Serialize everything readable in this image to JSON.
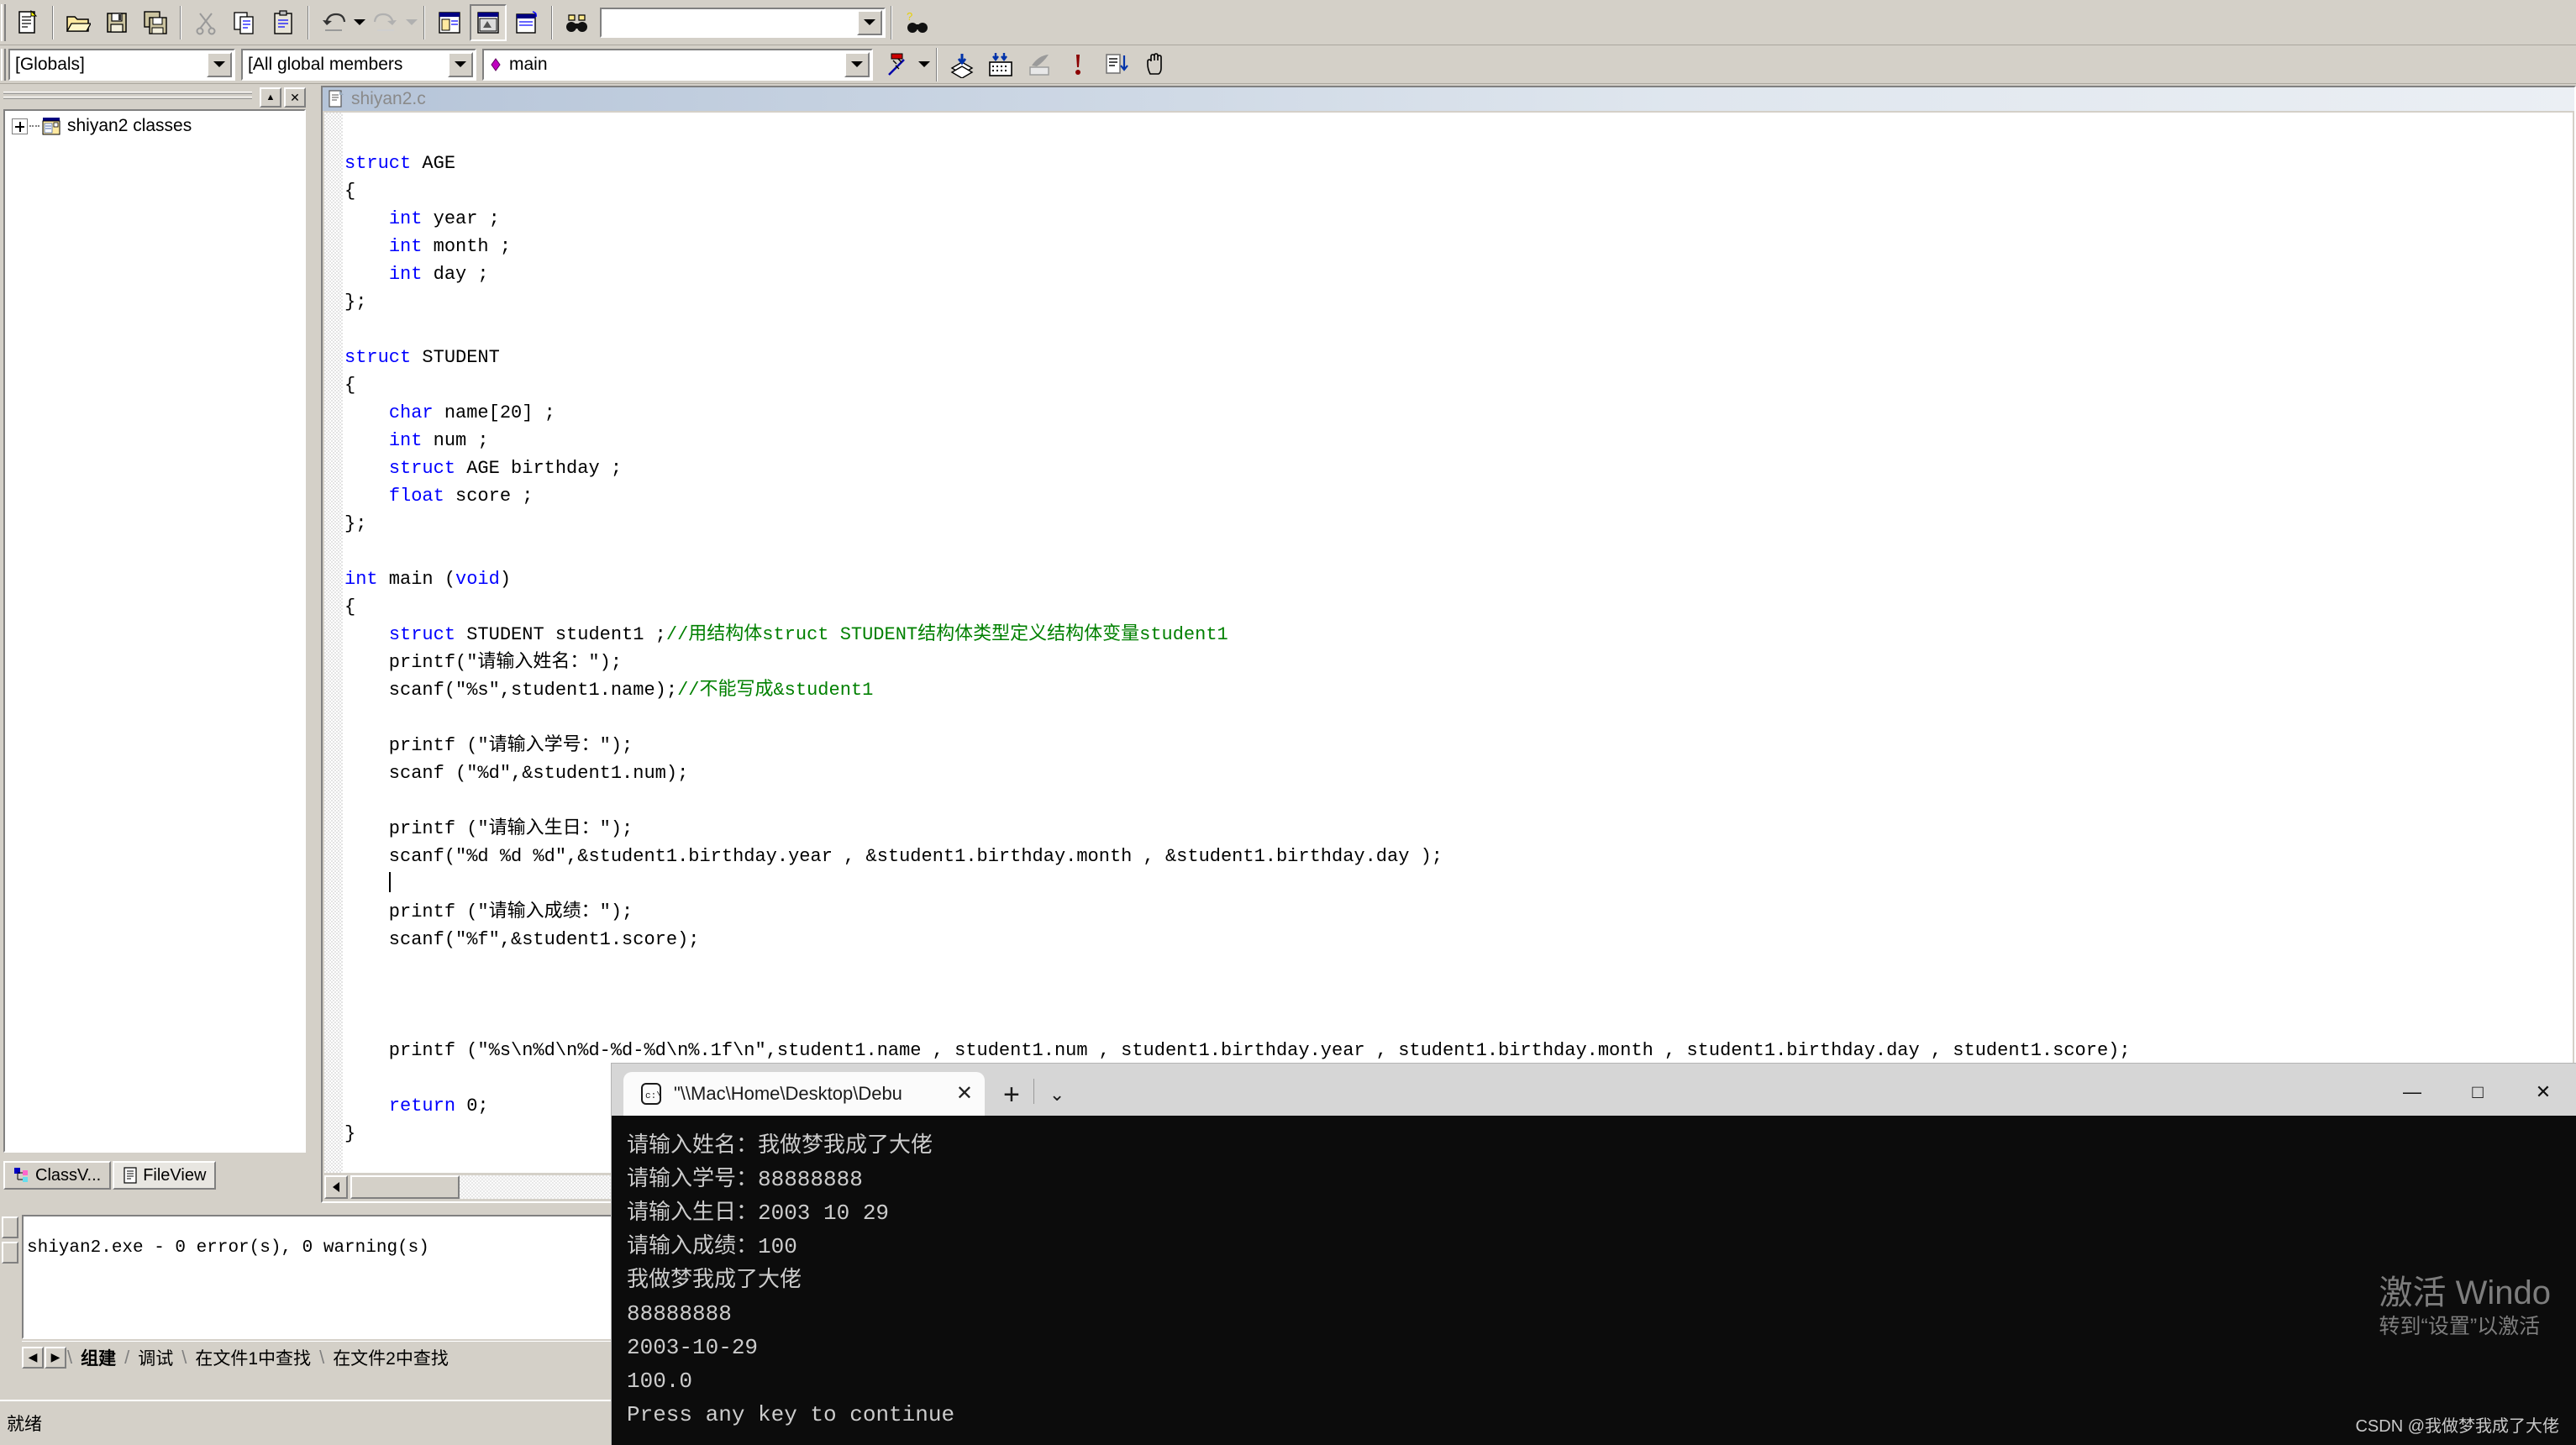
{
  "toolbar_standard": {
    "buttons": [
      {
        "name": "new-document-button",
        "icon": "new-document-icon"
      },
      {
        "name": "open-file-button",
        "icon": "open-folder-icon"
      },
      {
        "name": "save-button",
        "icon": "floppy-disk-icon"
      },
      {
        "name": "save-all-button",
        "icon": "save-all-icon"
      },
      {
        "name": "cut-button",
        "icon": "scissors-icon"
      },
      {
        "name": "copy-button",
        "icon": "copy-icon"
      },
      {
        "name": "paste-button",
        "icon": "clipboard-paste-icon"
      },
      {
        "name": "undo-button",
        "icon": "undo-arrow-icon"
      },
      {
        "name": "redo-button",
        "icon": "redo-arrow-icon"
      },
      {
        "name": "workspace-toggle-button",
        "icon": "workspace-window-icon"
      },
      {
        "name": "output-toggle-button",
        "icon": "output-window-icon"
      },
      {
        "name": "watch-toggle-button",
        "icon": "watch-window-icon"
      },
      {
        "name": "find-in-files-button",
        "icon": "binoculars-icon"
      }
    ],
    "find_combo": {
      "value": "",
      "placeholder": ""
    },
    "help_button": {
      "name": "find-help-button",
      "icon": "question-binoculars-icon"
    }
  },
  "wizard_bar": {
    "globals_combo": {
      "value": "[Globals]"
    },
    "members_combo": {
      "value": "[All global members"
    },
    "function_combo": {
      "value": "main",
      "icon": "magenta-diamond-icon"
    },
    "class_wizard_button": {
      "name": "class-wizard-button",
      "icon": "classwizard-icon"
    },
    "build_buttons": [
      {
        "name": "compile-button",
        "icon": "compile-stack-icon"
      },
      {
        "name": "build-button",
        "icon": "build-grid-icon"
      },
      {
        "name": "stop-build-button",
        "icon": "stop-build-icon"
      },
      {
        "name": "execute-program-button",
        "icon": "red-exclamation-icon"
      },
      {
        "name": "go-debug-button",
        "icon": "document-arrow-down-icon"
      },
      {
        "name": "insert-breakpoint-button",
        "icon": "hand-icon"
      }
    ]
  },
  "workspace": {
    "title_close_label": "✕",
    "title_up_label": "▲",
    "tree": {
      "root_label": "shiyan2 classes",
      "root_icon": "classes-folder-icon",
      "expander": "+"
    },
    "tabs": [
      {
        "label": "ClassV...",
        "icon": "classview-icon",
        "active": false
      },
      {
        "label": "FileView",
        "icon": "fileview-icon",
        "active": true
      }
    ]
  },
  "editor": {
    "tab_title": "shiyan2.c",
    "tab_icon": "c-source-file-icon",
    "code_lines": [
      [
        {
          "t": "struct",
          "c": "kw"
        },
        {
          "t": " AGE",
          "c": ""
        }
      ],
      [
        {
          "t": "{",
          "c": ""
        }
      ],
      [
        {
          "t": "    ",
          "c": ""
        },
        {
          "t": "int",
          "c": "kw"
        },
        {
          "t": " year ;",
          "c": ""
        }
      ],
      [
        {
          "t": "    ",
          "c": ""
        },
        {
          "t": "int",
          "c": "kw"
        },
        {
          "t": " month ;",
          "c": ""
        }
      ],
      [
        {
          "t": "    ",
          "c": ""
        },
        {
          "t": "int",
          "c": "kw"
        },
        {
          "t": " day ;",
          "c": ""
        }
      ],
      [
        {
          "t": "};",
          "c": ""
        }
      ],
      [
        {
          "t": "",
          "c": ""
        }
      ],
      [
        {
          "t": "struct",
          "c": "kw"
        },
        {
          "t": " STUDENT",
          "c": ""
        }
      ],
      [
        {
          "t": "{",
          "c": ""
        }
      ],
      [
        {
          "t": "    ",
          "c": ""
        },
        {
          "t": "char",
          "c": "kw"
        },
        {
          "t": " name[20] ;",
          "c": ""
        }
      ],
      [
        {
          "t": "    ",
          "c": ""
        },
        {
          "t": "int",
          "c": "kw"
        },
        {
          "t": " num ;",
          "c": ""
        }
      ],
      [
        {
          "t": "    ",
          "c": ""
        },
        {
          "t": "struct",
          "c": "kw"
        },
        {
          "t": " AGE birthday ;",
          "c": ""
        }
      ],
      [
        {
          "t": "    ",
          "c": ""
        },
        {
          "t": "float",
          "c": "kw"
        },
        {
          "t": " score ;",
          "c": ""
        }
      ],
      [
        {
          "t": "};",
          "c": ""
        }
      ],
      [
        {
          "t": "",
          "c": ""
        }
      ],
      [
        {
          "t": "int",
          "c": "kw"
        },
        {
          "t": " main (",
          "c": ""
        },
        {
          "t": "void",
          "c": "kw"
        },
        {
          "t": ")",
          "c": ""
        }
      ],
      [
        {
          "t": "{",
          "c": ""
        }
      ],
      [
        {
          "t": "    ",
          "c": ""
        },
        {
          "t": "struct",
          "c": "kw"
        },
        {
          "t": " STUDENT student1 ;",
          "c": ""
        },
        {
          "t": "//用结构体struct STUDENT结构体类型定义结构体变量student1",
          "c": "cm"
        }
      ],
      [
        {
          "t": "    printf(\"请输入姓名：\");",
          "c": ""
        }
      ],
      [
        {
          "t": "    scanf(\"%s\",student1.name);",
          "c": ""
        },
        {
          "t": "//不能写成&student1",
          "c": "cm"
        }
      ],
      [
        {
          "t": "",
          "c": ""
        }
      ],
      [
        {
          "t": "    printf (\"请输入学号：\");",
          "c": ""
        }
      ],
      [
        {
          "t": "    scanf (\"%d\",&student1.num);",
          "c": ""
        }
      ],
      [
        {
          "t": "",
          "c": ""
        }
      ],
      [
        {
          "t": "    printf (\"请输入生日：\");",
          "c": ""
        }
      ],
      [
        {
          "t": "    scanf(\"%d %d %d\",&student1.birthday.year , &student1.birthday.month , &student1.birthday.day );",
          "c": ""
        }
      ],
      [
        {
          "t": "__CARET__",
          "c": "caret"
        }
      ],
      [
        {
          "t": "    printf (\"请输入成绩：\");",
          "c": ""
        }
      ],
      [
        {
          "t": "    scanf(\"%f\",&student1.score);",
          "c": ""
        }
      ],
      [
        {
          "t": "",
          "c": ""
        }
      ],
      [
        {
          "t": "",
          "c": ""
        }
      ],
      [
        {
          "t": "",
          "c": ""
        }
      ],
      [
        {
          "t": "    printf (\"%s\\n%d\\n%d-%d-%d\\n%.1f\\n\",student1.name , student1.num , student1.birthday.year , student1.birthday.month , student1.birthday.day , student1.score);",
          "c": ""
        }
      ],
      [
        {
          "t": "",
          "c": ""
        }
      ],
      [
        {
          "t": "    ",
          "c": ""
        },
        {
          "t": "return",
          "c": "kw"
        },
        {
          "t": " 0;",
          "c": ""
        }
      ],
      [
        {
          "t": "}",
          "c": ""
        }
      ]
    ],
    "colors": {
      "keyword": "#0000ff",
      "comment": "#008000",
      "text": "#000000"
    }
  },
  "output_pane": {
    "text": "shiyan2.exe - 0 error(s), 0 warning(s)",
    "tabs": [
      {
        "label": "组建",
        "active": true
      },
      {
        "label": "调试",
        "active": false
      },
      {
        "label": "在文件1中查找",
        "active": false
      },
      {
        "label": "在文件2中查找",
        "active": false
      }
    ],
    "nav_prev": "◀",
    "nav_next": "▶"
  },
  "status_bar": {
    "text": "就绪"
  },
  "terminal": {
    "tab_title": "\"\\\\Mac\\Home\\Desktop\\Debu",
    "tab_icon": "console-icon",
    "tab_close": "✕",
    "new_tab": "+",
    "dropdown": "⌄",
    "window_buttons": [
      {
        "name": "minimize-button",
        "glyph": "—"
      },
      {
        "name": "maximize-button",
        "glyph": "□"
      },
      {
        "name": "close-button",
        "glyph": "✕"
      }
    ],
    "console_lines": [
      "请输入姓名：我做梦我成了大佬",
      "请输入学号：88888888",
      "请输入生日：2003 10 29",
      "请输入成绩：100",
      "我做梦我成了大佬",
      "88888888",
      "2003-10-29",
      "100.0",
      "Press any key to continue"
    ],
    "background": "#0c0c0c",
    "foreground": "#cccccc"
  },
  "watermark": {
    "line1": "激活 Windo",
    "line2": "转到“设置”以激活"
  },
  "attribution": {
    "text": "CSDN @我做梦我成了大佬"
  }
}
